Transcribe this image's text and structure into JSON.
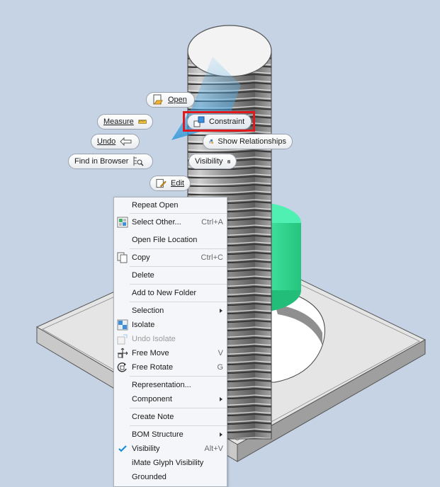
{
  "marking_menu": {
    "open": "Open",
    "measure": "Measure",
    "constraint": "Constraint",
    "undo": "Undo",
    "show_relationships": "Show Relationships",
    "find_in_browser": "Find in Browser",
    "visibility": "Visibility",
    "edit": "Edit"
  },
  "context_menu": {
    "repeat_open": "Repeat Open",
    "select_other": "Select Other...",
    "select_other_shortcut": "Ctrl+A",
    "open_file_location": "Open File Location",
    "copy": "Copy",
    "copy_shortcut": "Ctrl+C",
    "delete": "Delete",
    "add_to_new_folder": "Add to New Folder",
    "selection": "Selection",
    "isolate": "Isolate",
    "undo_isolate": "Undo Isolate",
    "free_move": "Free Move",
    "free_move_shortcut": "V",
    "free_rotate": "Free Rotate",
    "free_rotate_shortcut": "G",
    "representation": "Representation...",
    "component": "Component",
    "create_note": "Create Note",
    "bom_structure": "BOM Structure",
    "visibility": "Visibility",
    "visibility_shortcut": "Alt+V",
    "imate_glyph_visibility": "iMate Glyph Visibility",
    "grounded": "Grounded"
  },
  "colors": {
    "background": "#c5d3e5",
    "nut": "#3be49c",
    "highlight_box": "#e0191e",
    "check": "#1e8fd6"
  }
}
